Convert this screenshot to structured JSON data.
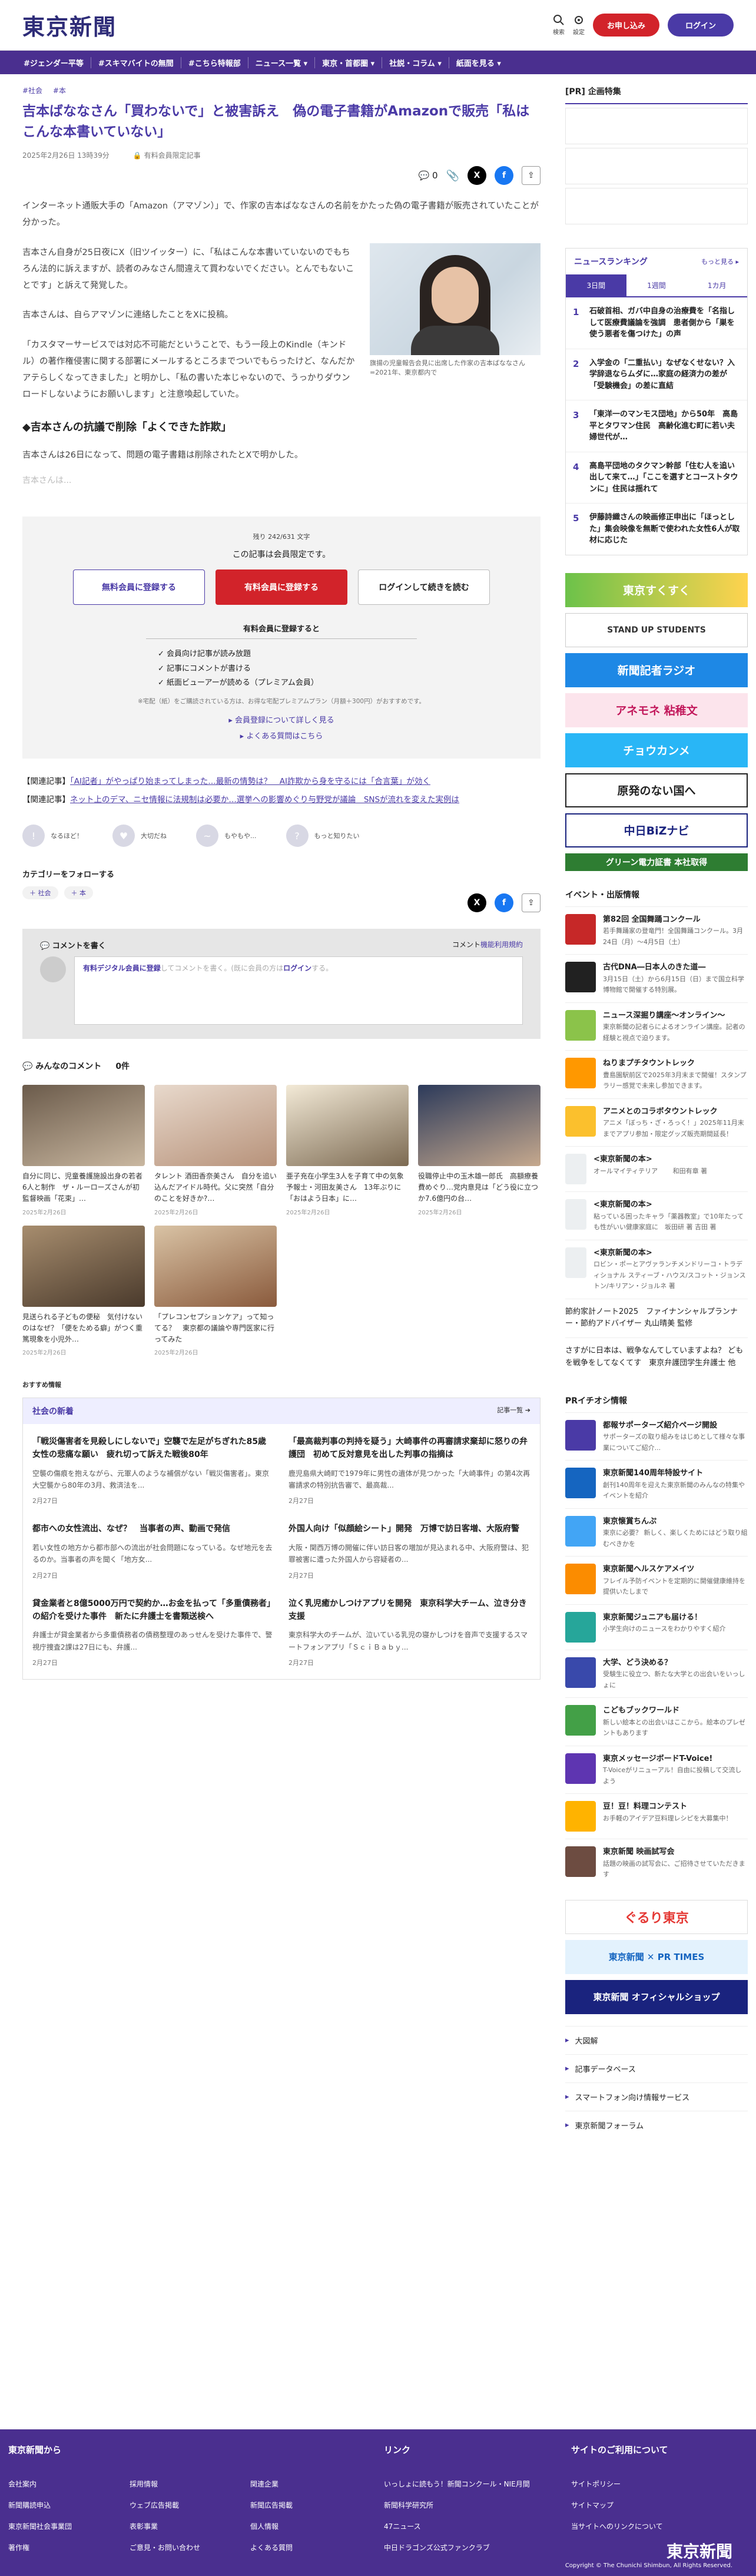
{
  "header": {
    "logo": "東京新聞",
    "search_label": "検索",
    "settings_label": "設定",
    "subscribe": "お申し込み",
    "login": "ログイン"
  },
  "nav": [
    "#ジェンダー平等",
    "#スキマバイトの無間",
    "#こちら特報部",
    "ニュース一覧 ▾",
    "東京・首都圏 ▾",
    "社説・コラム ▾",
    "紙面を見る ▾"
  ],
  "article": {
    "breadcrumbs": [
      "#社会",
      "#本"
    ],
    "title": "吉本ばななさん「買わないで」と被害訴え　偽の電子書籍がAmazonで販売「私はこんな本書いていない」",
    "date": "2025年2月26日 13時39分",
    "member_label": "有料会員限定記事",
    "comment_count": "0",
    "lead": "インターネット通販大手の「Amazon（アマゾン）」で、作家の吉本ばななさんの名前をかたった偽の電子書籍が販売されていたことが分かった。",
    "p1": "吉本さん自身が25日夜にX（旧ツイッター）に、「私はこんな本書いていないのでもちろん法的に訴えますが、読者のみなさん間違えて買わないでください。とんでもないことです」と訴えて発覚した。",
    "p2": "吉本さんは、自らアマゾンに連絡したことをXに投稿。",
    "p3": "「カスタマーサービスでは対応不可能だということで、もう一段上のKindle（キンドル）の著作権侵害に関する部署にメールするところまでついでもらったけど、なんだかアテらしくなってきました」と明かし、「私の書いた本じゃないので、うっかりダウンロードしないようにお願いします」と注意喚起していた。",
    "photo_caption": "旗揚の児童報告会見に出席した作家の吉本ばななさん=2021年、東京都内で",
    "subhead": "◆吉本さんの抗議で削除「よくできた詐欺」",
    "p4": "吉本さんは26日になって、問題の電子書籍は削除されたとXで明かした。",
    "fade": "吉本さんは..."
  },
  "paywall": {
    "remaining": "残り 242/631 文字",
    "message": "この記事は会員限定です。",
    "free_btn": "無料会員に登録する",
    "paid_btn": "有料会員に登録する",
    "login_btn": "ログインして続きを読む",
    "benefit_title": "有料会員に登録すると",
    "benefits": [
      "✓ 会員向け記事が読み放題",
      "✓ 記事にコメントが書ける",
      "✓ 紙面ビューアーが読める（プレミアム会員）"
    ],
    "note": "※宅配（紙）をご購読されている方は、お得な宅配プレミアムプラン（月額＋300円）がおすすめです。",
    "link1": "▸ 会員登録について詳しく見る",
    "link2": "▸ よくある質問はこちら"
  },
  "related": [
    {
      "label": "【関連記事】",
      "text": "「AI記者」がやっぱり始まってしまった…最新の情勢は？　AI詐欺から身を守るには「合言葉」が効く"
    },
    {
      "label": "【関連記事】",
      "text": "ネット上のデマ、ニセ情報に法規制は必要か…選挙への影響めぐり与野党が議論　SNSが流れを変えた実例は"
    }
  ],
  "reactions": [
    "なるほど！",
    "大切だね",
    "もやもや...",
    "もっと知りたい"
  ],
  "follow_label": "カテゴリーをフォローする",
  "follow_tags": [
    "＋ 社会",
    "＋ 本"
  ],
  "comments": {
    "write_label": "コメントを書く",
    "rule_prefix": "コメント",
    "rule_link": "機能利用規約",
    "placeholder_link": "有料デジタル会員に登録",
    "placeholder_mid": "してコメントを書く。(既に会員の方は",
    "placeholder_login": "ログイン",
    "placeholder_end": "する。",
    "all_label": "みんなのコメント",
    "all_count": "0件"
  },
  "cards": [
    {
      "title": "自分に同じ、児童養護施設出身の若者6人と制作　ザ・ルーローズさんが初監督映画「花束」…",
      "date": "2025年2月26日"
    },
    {
      "title": "タレント 酒田香奈美さん　自分を追い込んだアイドル時代。父に突然「自分のことを好きか?…",
      "date": "2025年2月26日"
    },
    {
      "title": "亜子充在小学生3人を子育て中の気象予報士・河田友美さん　13年ぶりに「おはよう日本」に…",
      "date": "2025年2月26日"
    },
    {
      "title": "役職停止中の玉木雄一郎氏　高額療養費めぐり…党内意見は「どう役に立つか7.6億円の台…",
      "date": "2025年2月26日"
    },
    {
      "title": "見送られる子どもの便秘　気付けないのはなぜ？「便をためる癖」がつく重篤現象を小児外…",
      "date": "2025年2月26日"
    },
    {
      "title": "「プレコンセプションケア」って知ってる？　東京都の議論や専門医家に行ってみた",
      "date": "2025年2月26日"
    }
  ],
  "recommend_label": "おすすめ情報",
  "society": {
    "title": "社会の新着",
    "more": "記事一覧 ➔",
    "items": [
      {
        "title": "「戦災傷害者を見殺しにしないで」空襲で左足がちぎれた85歳女性の悲痛な願い　疲れ切って訴えた戦後80年",
        "sub": "空襲の傷痕を抱えながら、元軍人のような補償がない「戦災傷害者」。東京大空襲から80年の3月、救済法を...",
        "date": "2月27日"
      },
      {
        "title": "「最高裁判事の判持を疑う」大崎事件の再審請求棄却に怒りの弁護団　初めて反対意見を出した判事の指摘は",
        "sub": "鹿児島県大崎町で1979年に男性の遺体が見つかった「大崎事件」の第4次再審請求の特別抗告審で、最高裁...",
        "date": "2月27日"
      },
      {
        "title": "都市への女性流出、なぜ？　当事者の声、動画で発信",
        "sub": "若い女性の地方から都市部への流出が社会問題になっている。なぜ地元を去るのか。当事者の声を聞く「地方女...",
        "date": "2月27日"
      },
      {
        "title": "外国人向け「似顔絵シート」開発　万博で訪日客増、大阪府警",
        "sub": "大阪・関西万博の開催に伴い訪日客の増加が見込まれる中、大阪府警は、犯罪被害に遭った外国人から容疑者の...",
        "date": "2月27日"
      },
      {
        "title": "貸金業者と8億5000万円で契約か…お金を払って「多重債務者」の紹介を受けた事件　新たに弁護士を書類送検へ",
        "sub": "弁護士が貸金業者から多重債務者の債務整理のあっせんを受けた事件で、警視庁捜査2課は27日にも、弁護...",
        "date": "2月27日"
      },
      {
        "title": "泣く乳児癒かしつけアプリを開発　東京科学大チーム、泣き分き支援",
        "sub": "東京科学大のチームが、泣いている乳児の寝かしつけを音声で支援するスマートフォンアプリ「ＳｃｉＢａｂｙ...",
        "date": "2月27日"
      }
    ]
  },
  "sidebar": {
    "pr_title": "[PR] 企画特集",
    "ranking_title": "ニュースランキング",
    "ranking_more": "もっと見る ▸",
    "ranking_tabs": [
      "3日間",
      "1週間",
      "1カ月"
    ],
    "ranking": [
      {
        "n": "1",
        "t": "石破首相、ガバ中自身の治療費を「名指しして医療費議論を強調　患者側から「巣を使う悪者を傷つけた」の声"
      },
      {
        "n": "2",
        "t": "入学金の「二重払い」なぜなくせない？入学辞退ならムダに…家庭の経済力の差が「受験機会」の差に直結"
      },
      {
        "n": "3",
        "t": "「東洋一のマンモス団地」から50年　高島平とタワマン住民　高齢化進む町に若い夫婦世代が…"
      },
      {
        "n": "4",
        "t": "高島平団地のタクマン幹部「住む人を追い出して来て…」「ここを選すとコーストタウンに」住民は揺れて"
      },
      {
        "n": "5",
        "t": "伊藤詩織さんの映画修正申出に「ほっとした」集会映像を無断で使われた女性6人が取材に応じた"
      }
    ],
    "banners": [
      "東京すくすく",
      "STAND UP STUDENTS",
      "新聞記者ラジオ",
      "アネモネ 粘稚文",
      "チョウカンメ",
      "原発のない国へ",
      "中日BiZナビ",
      "グリーン電力証書 本社取得"
    ],
    "events_title": "イベント・出版情報",
    "events": [
      {
        "t": "第82回 全国舞踊コンクール",
        "s": "若手舞踊家の登竜門！全国舞踊コンクール。3月24日（月）〜4月5日（土）"
      },
      {
        "t": "古代DNA―日本人のきた道―",
        "s": "3月15日（土）から6月15日（日）まで国立科学博物館で開催する特別展。"
      },
      {
        "t": "ニュース深掘り講座〜オンライン〜",
        "s": "東京新聞の記者らによるオンライン講座。記者の経験と視点で迫ります。"
      },
      {
        "t": "ねりまプチタウントレック",
        "s": "豊島園駅前区で2025年3月末まで開催！スタンプラリー感覚で未来し参加できます。"
      },
      {
        "t": "アニメとのコラボタウントレック",
        "s": "アニメ「ぼっち・ざ・ろっく！」2025年11月末までアプリ参加・限定グッズ販売期間延長！"
      },
      {
        "t": "<東京新聞の本>",
        "s": "オールマイティテリア 　　和田有章 著"
      },
      {
        "t": "<東京新聞の本>",
        "s": "粘っている困ったキャラ「薬器教室」で10年たっても性がいい健康家庭に　坂田研 著 吉田 著"
      },
      {
        "t": "<東京新聞の本>",
        "s": "ロビン・ポーとアヴァランチメンドリーコ・トラディショナル スティーブ・ハウス/スコット・ジョンストン/キリアン・ジョルネ 著"
      }
    ],
    "plain": [
      "節約家計ノート2025　ファイナンシャルプランナー・節約アドバイザー 丸山晴美 監修",
      "さすがに日本は、戦争なんてしていますよね？ どもを戦争をしてなくてす　東京弁護団学生弁護士 他"
    ],
    "pr_info_title": "PRイチオシ情報",
    "pr_items": [
      {
        "t": "都報サポーターズ紹介ページ開設",
        "s": "サポーターズの取り組みをはじめとして様々な事業についてご紹介..."
      },
      {
        "t": "東京新聞140周年特設サイト",
        "s": "創刊140周年を迎えた東京新聞のみんなの特集やイベントを紹介"
      },
      {
        "t": "東京懐賞ちんぷ",
        "s": "東京に必要？ 新しく、楽しくためにはどう取り組むべきかを"
      },
      {
        "t": "東京新聞ヘルスケアメイツ",
        "s": "フレイル予防イベントを定期的に開催健康維持を提供いたしまで"
      },
      {
        "t": "東京新聞ジュニアも届ける！",
        "s": "小学生向けのニュースをわかりやすく紹介"
      },
      {
        "t": "大学、どう決める？",
        "s": "受験生に役立つ、新たな大学との出会いをいっしょに"
      },
      {
        "t": "こどもブックワールド",
        "s": "新しい絵本との出会いはここから。絵本のプレゼントもあります"
      },
      {
        "t": "東京メッセージボードT-Voice!",
        "s": "T-Voiceがリニューアル！自由に投稿して交流しよう"
      },
      {
        "t": "豆！豆！料理コンテスト",
        "s": "お手軽のアイデア豆料理レシピを大募集中！"
      },
      {
        "t": "東京新聞 映画試写会",
        "s": "話題の映画の試写会に、ご招待させていただきます"
      }
    ],
    "links": [
      "大図解",
      "記事データベース",
      "スマートフォン向け情報サービス",
      "東京新聞フォーラム"
    ],
    "gurutto": "ぐるり東京",
    "pr_times": "東京新聞 ✕ PR TIMES",
    "shop": "東京新聞 オフィシャルショップ"
  },
  "footer": {
    "col1_title": "東京新聞から",
    "col1a": [
      "会社案内",
      "新聞購読申込",
      "東京新聞社会事業団",
      "著作権"
    ],
    "col1b": [
      "採用情報",
      "ウェブ広告掲載",
      "表彰事業",
      "ご意見・お問い合わせ"
    ],
    "col1c": [
      "関連企業",
      "新聞広告掲載",
      "個人情報",
      "よくある質問"
    ],
    "col2_title": "リンク",
    "col2": [
      "いっしょに読もう！新聞コンクール・NIE月間",
      "新聞科学研究所",
      "47ニュース",
      "中日ドラゴンズ公式ファンクラブ"
    ],
    "col3_title": "サイトのご利用について",
    "col3": [
      "サイトポリシー",
      "サイトマップ",
      "当サイトへのリンクについて"
    ],
    "logo": "東京新聞",
    "copyright": "Copyright © The Chunichi Shimbun, All Rights Reserved."
  }
}
